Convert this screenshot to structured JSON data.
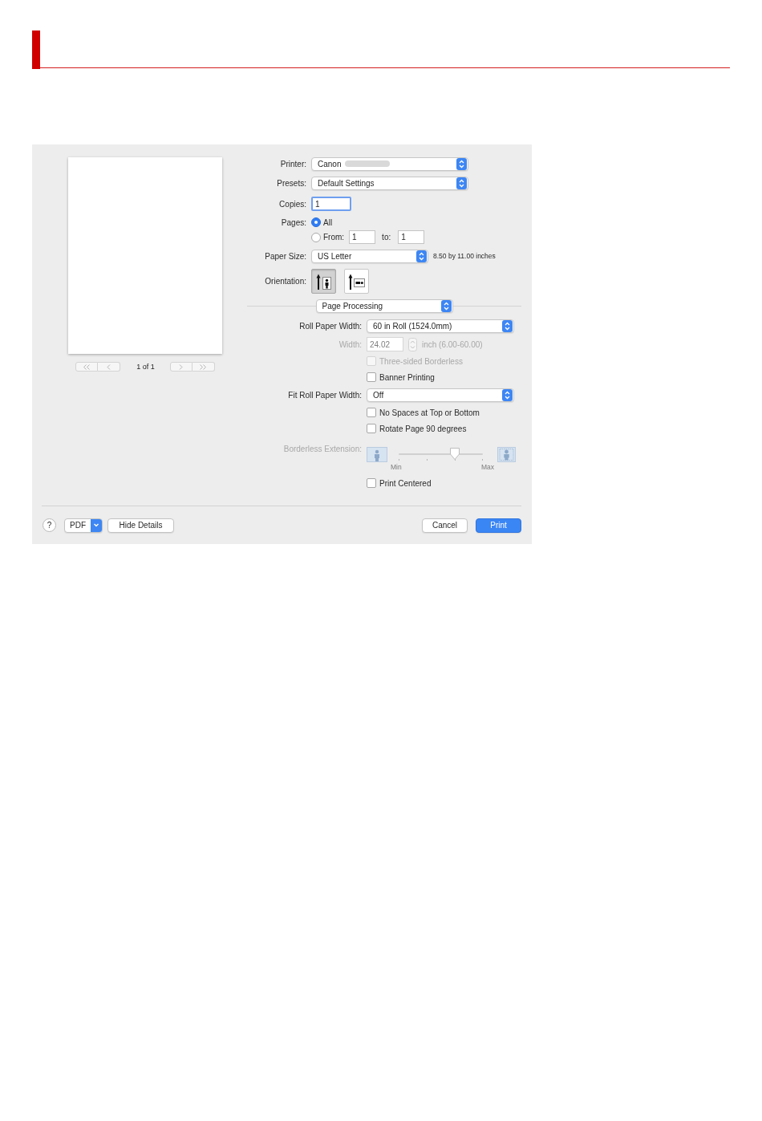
{
  "print_dialog": {
    "preview": {
      "nav_left": [
        {
          "kind": "first",
          "disabled": true
        },
        {
          "kind": "previous",
          "disabled": true
        }
      ],
      "page_indicator": "1 of 1",
      "nav_right": [
        {
          "kind": "next",
          "disabled": true
        },
        {
          "kind": "last",
          "disabled": true
        }
      ]
    },
    "printer": {
      "label": "Printer:",
      "value": "Canon",
      "model_blurred": true
    },
    "presets": {
      "label": "Presets:",
      "value": "Default Settings"
    },
    "copies": {
      "label": "Copies:",
      "value": "1",
      "focused": true
    },
    "pages": {
      "label": "Pages:",
      "options": [
        {
          "kind": "all",
          "label": "All",
          "selected": true
        },
        {
          "kind": "range",
          "label": "From:",
          "selected": false,
          "from": "1",
          "to_label": "to:",
          "to": "1"
        }
      ]
    },
    "paper_size": {
      "label": "Paper Size:",
      "value": "US Letter",
      "dimensions": "8.50 by 11.00 inches"
    },
    "orientation": {
      "label": "Orientation:",
      "options": [
        {
          "kind": "portrait",
          "selected": true
        },
        {
          "kind": "landscape",
          "selected": false
        }
      ]
    },
    "panel_menu": {
      "value": "Page Processing"
    },
    "settings": [
      {
        "kind": "popup",
        "label": "Roll Paper Width:",
        "value": "60 in Roll (1524.0mm)",
        "disabled": false
      },
      {
        "kind": "number",
        "label": "Width:",
        "value": "24.02",
        "unit": "inch (6.00-60.00)",
        "disabled": true
      },
      {
        "kind": "checkbox",
        "label": "Three-sided Borderless",
        "checked": false,
        "disabled": true
      },
      {
        "kind": "checkbox",
        "label": "Banner Printing",
        "checked": false,
        "disabled": false
      },
      {
        "kind": "popup",
        "label": "Fit Roll Paper Width:",
        "value": "Off",
        "disabled": false
      },
      {
        "kind": "checkbox",
        "label": "No Spaces at Top or Bottom",
        "checked": false,
        "disabled": false
      },
      {
        "kind": "checkbox",
        "label": "Rotate Page 90 degrees",
        "checked": false,
        "disabled": false
      },
      {
        "kind": "slider",
        "label": "Borderless Extension:",
        "level": 0.67,
        "min_label": "Min",
        "max_label": "Max",
        "disabled": true
      },
      {
        "kind": "checkbox",
        "label": "Print Centered",
        "checked": false,
        "disabled": false
      }
    ],
    "footer": {
      "help": "?",
      "pdf_menu": "PDF",
      "details_button": "Hide Details",
      "buttons": [
        {
          "label": "Cancel",
          "default": false
        },
        {
          "label": "Print",
          "default": true
        }
      ]
    }
  }
}
